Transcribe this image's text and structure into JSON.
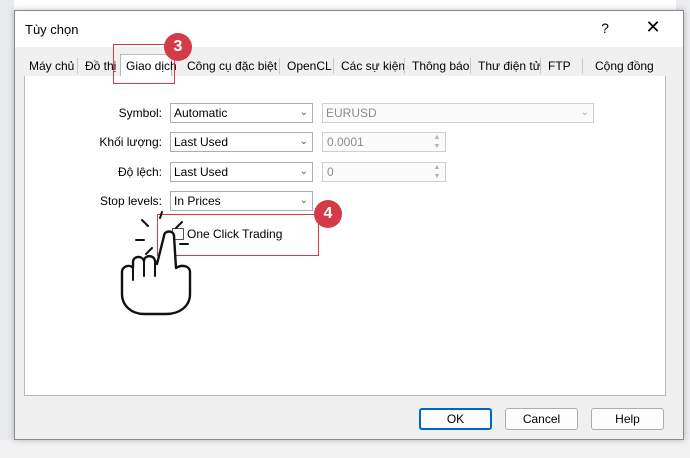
{
  "dialog": {
    "title": "Tùy chọn",
    "help_label": "?",
    "close_label": "✕"
  },
  "tabs": [
    {
      "label": "Máy chủ"
    },
    {
      "label": "Đồ thị"
    },
    {
      "label": "Giao dịch"
    },
    {
      "label": "Công cụ đặc biệt"
    },
    {
      "label": "OpenCL"
    },
    {
      "label": "Các sự kiện"
    },
    {
      "label": "Thông báo"
    },
    {
      "label": "Thư điện tử"
    },
    {
      "label": "FTP"
    },
    {
      "label": "Cộng đồng"
    }
  ],
  "form": {
    "symbol": {
      "label": "Symbol:",
      "value": "Automatic",
      "symbol_value": "EURUSD"
    },
    "volume": {
      "label": "Khối lượng:",
      "value": "Last Used",
      "amount": "0.0001"
    },
    "deviation": {
      "label": "Độ lệch:",
      "value": "Last Used",
      "amount": "0"
    },
    "stop_levels": {
      "label": "Stop levels:",
      "value": "In Prices"
    },
    "one_click": {
      "label": "One Click Trading",
      "checked": false
    }
  },
  "annotations": {
    "step_tab": "3",
    "step_checkbox": "4",
    "color": "#d23b47"
  },
  "buttons": {
    "ok": "OK",
    "cancel": "Cancel",
    "help": "Help"
  }
}
